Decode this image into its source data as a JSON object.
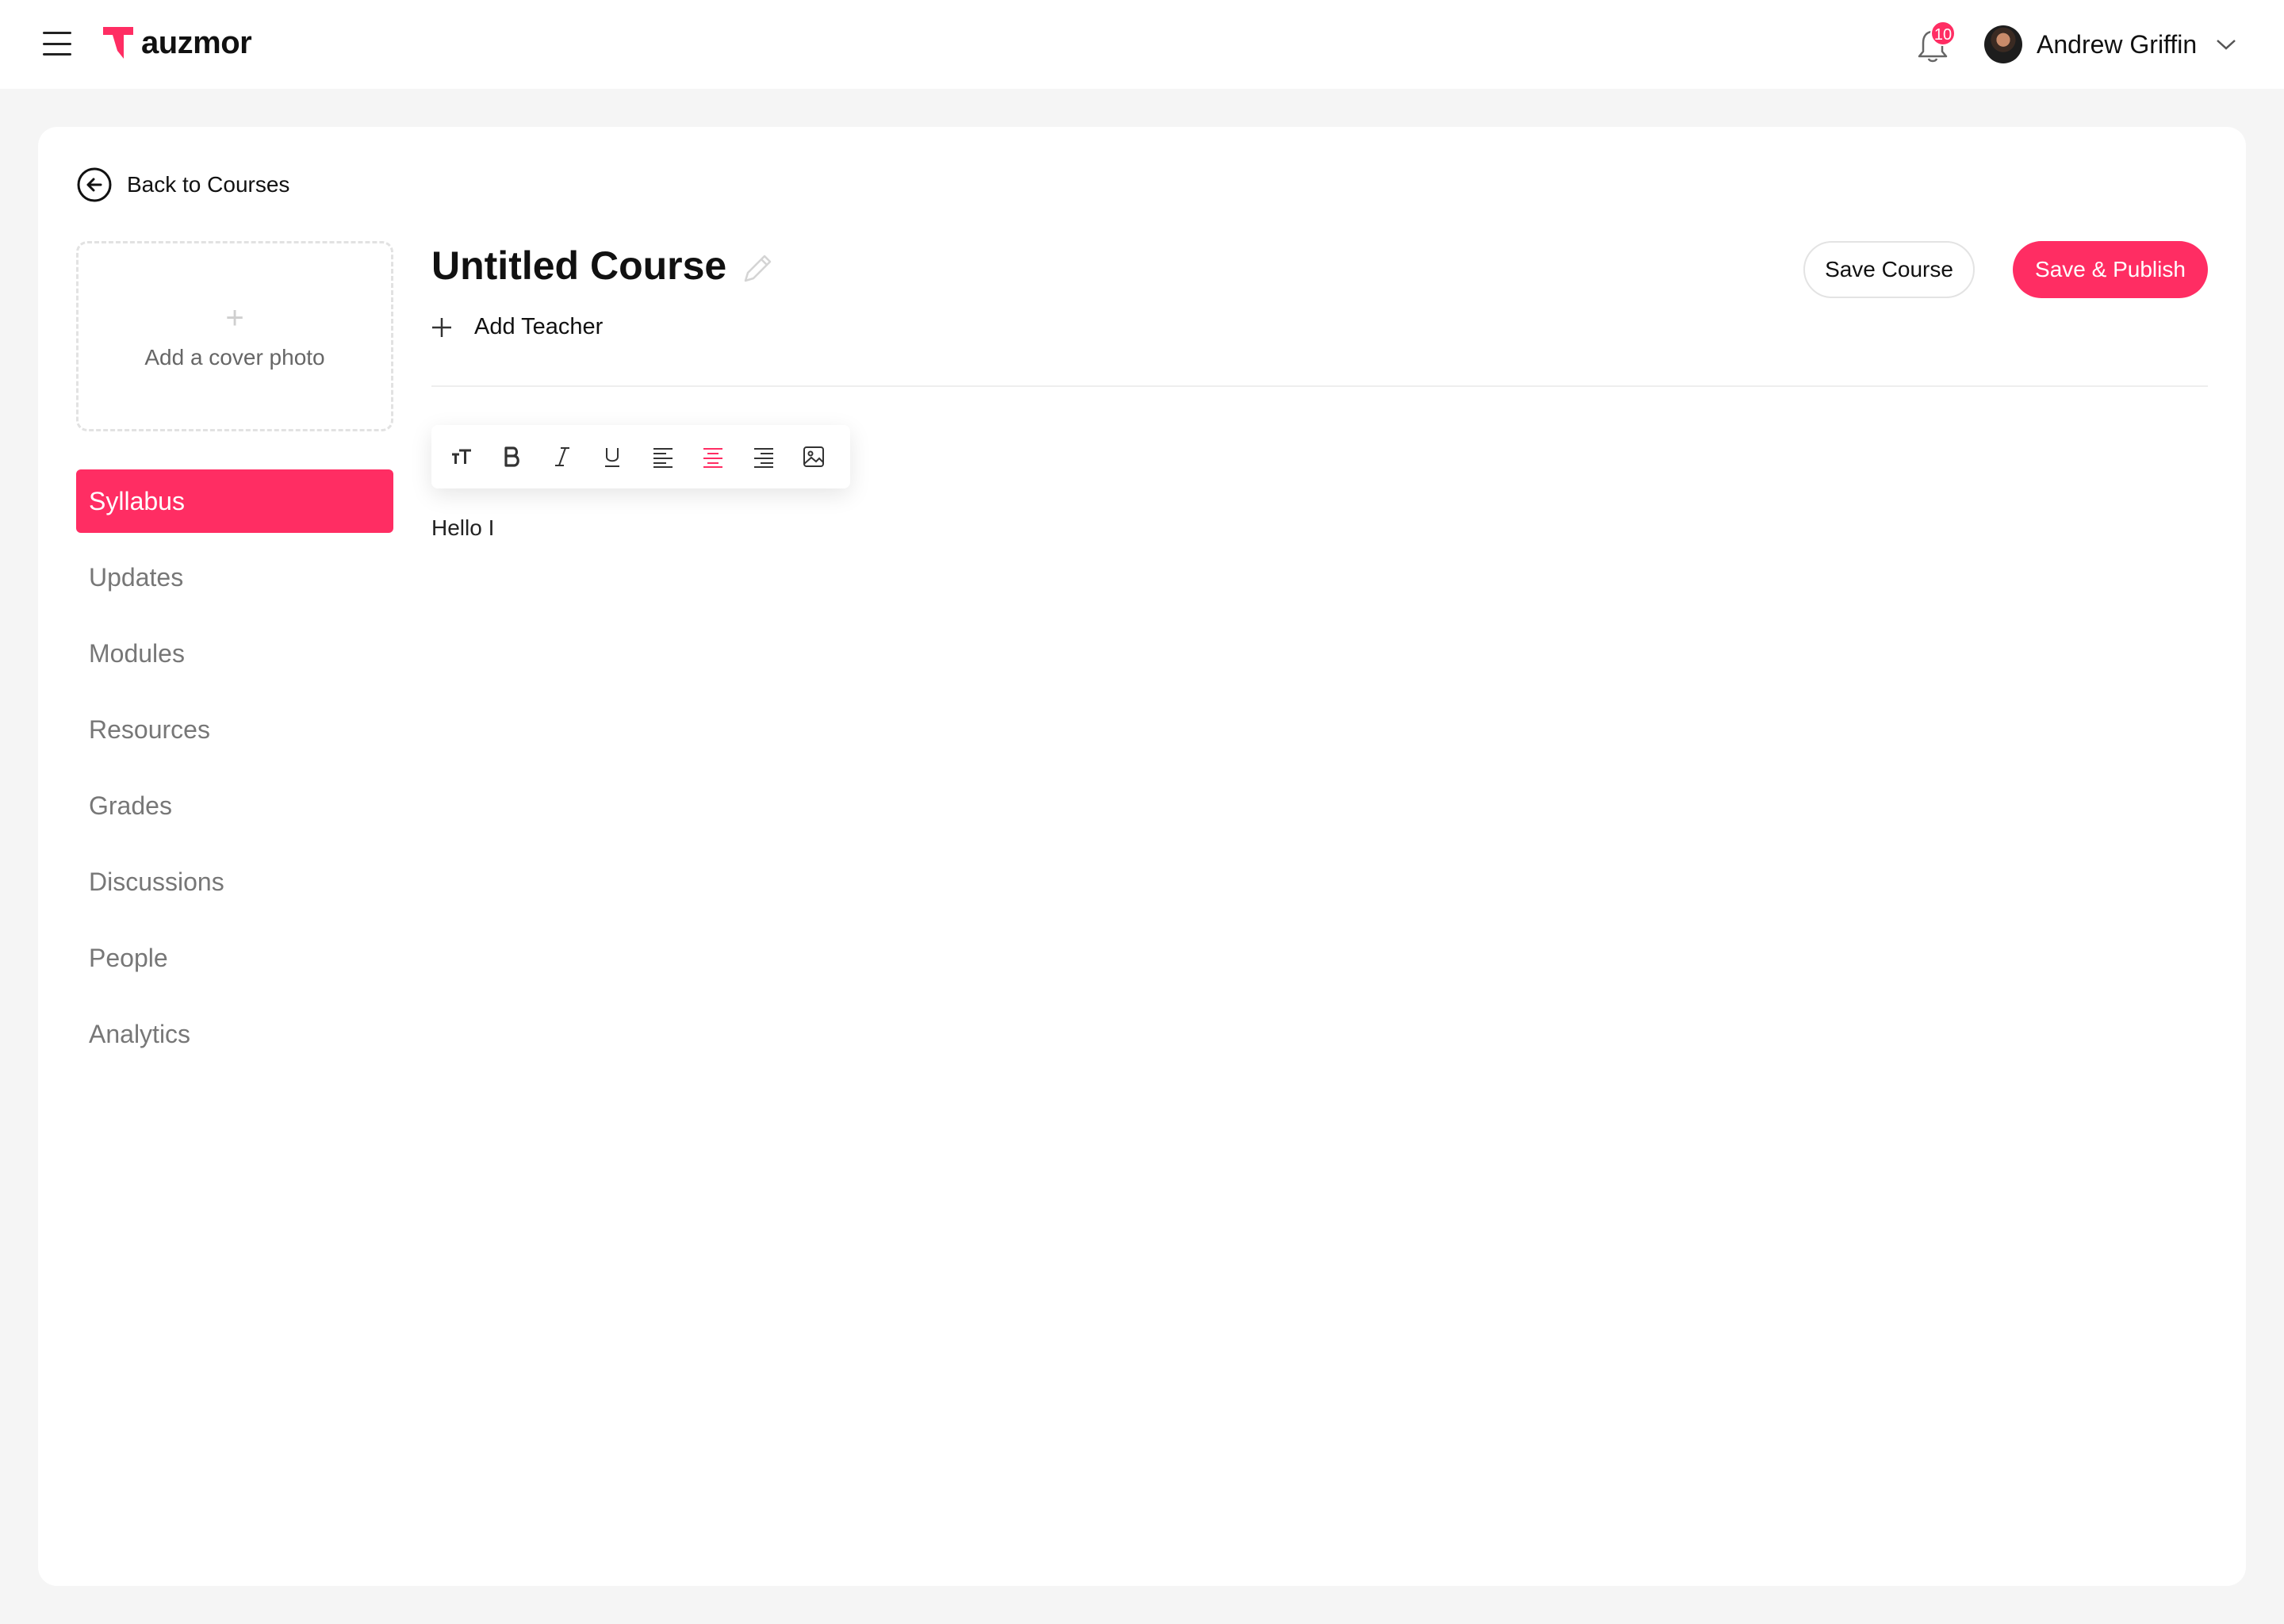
{
  "brand": {
    "name": "auzmor",
    "accent": "#ff2d63"
  },
  "header": {
    "menu_icon": "hamburger-icon",
    "notifications": {
      "icon": "bell-icon",
      "count": "10"
    },
    "user": {
      "name": "Andrew Griffin",
      "menu_icon": "chevron-down-icon"
    }
  },
  "back_link": {
    "label": "Back to Courses",
    "icon": "arrow-left-circle-icon"
  },
  "cover_photo": {
    "label": "Add a cover photo",
    "icon": "plus-icon"
  },
  "sidebar": {
    "items": [
      {
        "label": "Syllabus",
        "active": true
      },
      {
        "label": "Updates"
      },
      {
        "label": "Modules"
      },
      {
        "label": "Resources"
      },
      {
        "label": "Grades"
      },
      {
        "label": "Discussions"
      },
      {
        "label": "People"
      },
      {
        "label": "Analytics"
      }
    ]
  },
  "course": {
    "title": "Untitled Course",
    "edit_icon": "pencil-icon",
    "add_teacher_label": "Add Teacher"
  },
  "actions": {
    "save_label": "Save Course",
    "publish_label": "Save & Publish"
  },
  "toolbar": {
    "tools": [
      "text-size-icon",
      "bold-icon",
      "italic-icon",
      "underline-icon",
      "align-left-icon",
      "align-center-icon",
      "align-right-icon",
      "image-icon"
    ],
    "active_tool": "align-center-icon"
  },
  "editor": {
    "content": "Hello I"
  }
}
